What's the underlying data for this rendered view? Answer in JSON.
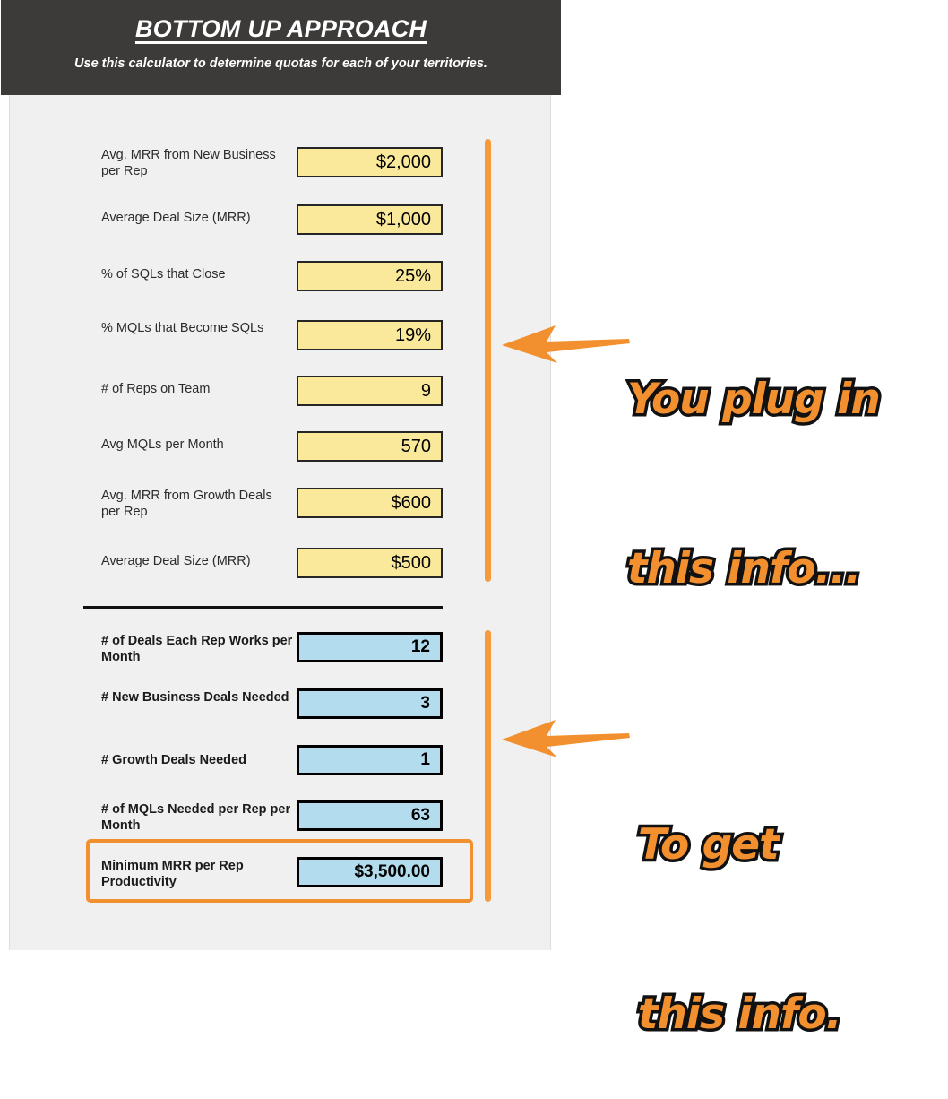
{
  "header": {
    "title": "BOTTOM UP APPROACH",
    "subtitle": "Use this calculator to determine quotas for each of your territories."
  },
  "inputs": {
    "section_kind": "user-entered",
    "rows": [
      {
        "label": "Avg. MRR from New Business per Rep",
        "value": "$2,000"
      },
      {
        "label": "Average Deal Size (MRR)",
        "value": "$1,000"
      },
      {
        "label": "% of SQLs that Close",
        "value": "25%"
      },
      {
        "label": "% MQLs that Become SQLs",
        "value": "19%"
      },
      {
        "label": "# of Reps on Team",
        "value": "9"
      },
      {
        "label": "Avg MQLs per Month",
        "value": "570"
      },
      {
        "label": "Avg. MRR from Growth Deals per Rep",
        "value": "$600"
      },
      {
        "label": "Average Deal Size (MRR)",
        "value": "$500"
      }
    ]
  },
  "outputs": {
    "section_kind": "calculated",
    "rows": [
      {
        "label": "# of Deals Each Rep Works per Month",
        "value": "12"
      },
      {
        "label": "# New Business Deals Needed",
        "value": "3"
      },
      {
        "label": "# Growth Deals Needed",
        "value": "1"
      },
      {
        "label": "# of MQLs Needed per Rep per Month",
        "value": "63"
      },
      {
        "label": "Minimum MRR per Rep Productivity",
        "value": "$3,500.00"
      }
    ]
  },
  "callouts": {
    "top": {
      "line1": "You plug in",
      "line2": "this info..."
    },
    "bottom": {
      "line1": "To get",
      "line2": "this info."
    }
  },
  "colors": {
    "header_bg": "#3d3b3a",
    "panel_bg": "#f0f0f0",
    "input_fill": "#fae99a",
    "output_fill": "#b3dcee",
    "accent_orange": "#f2902f",
    "bar_orange": "#f79a3c",
    "border_black": "#000000"
  }
}
